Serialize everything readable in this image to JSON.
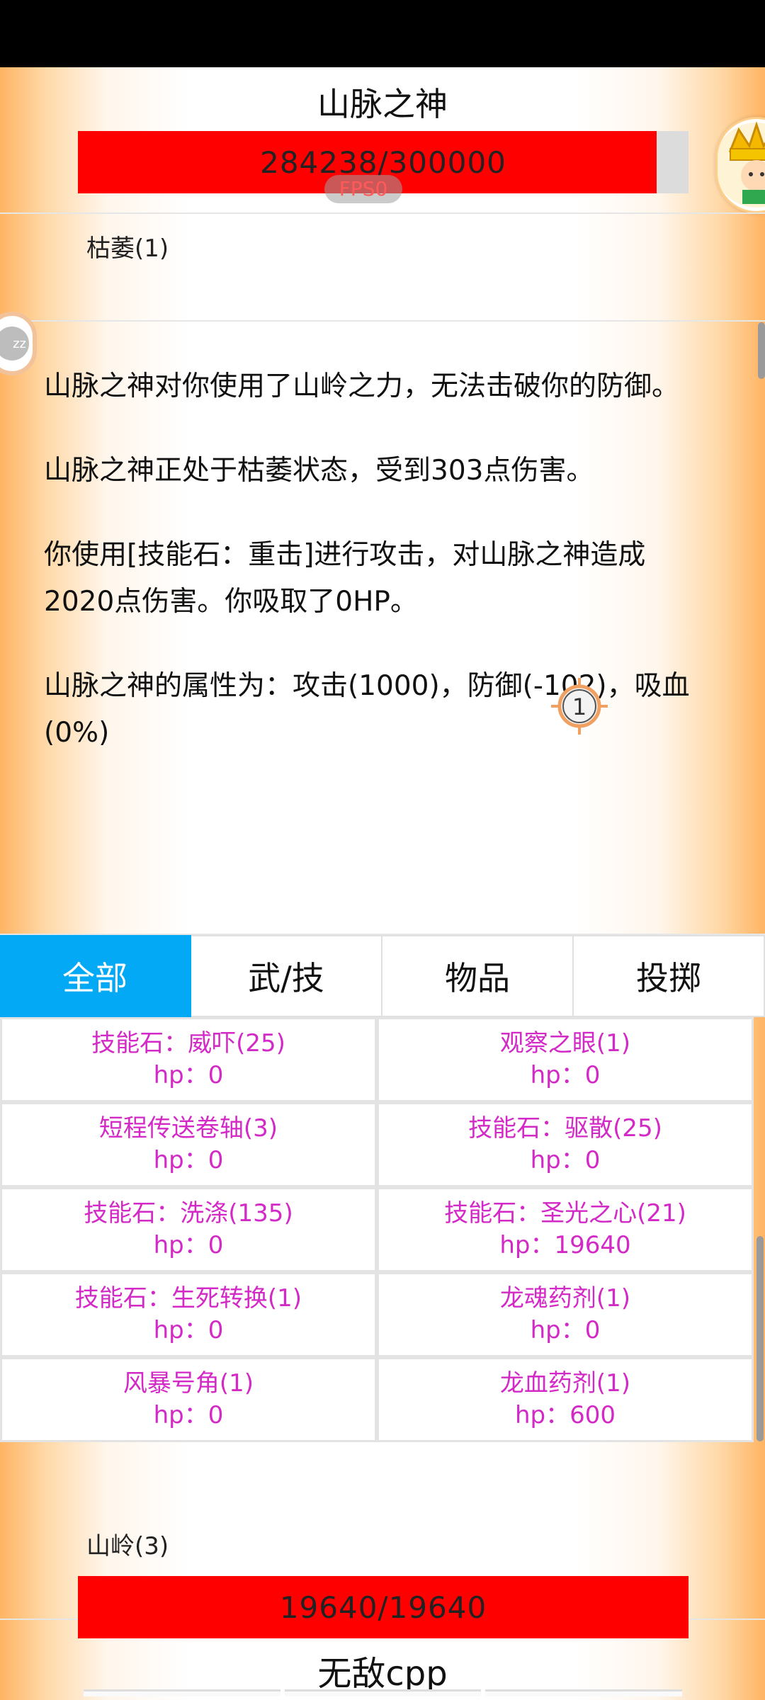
{
  "boss": {
    "name": "山脉之神",
    "hp_text": "284238/300000",
    "hp_fraction": 0.9475
  },
  "fps_label": "FPS0",
  "boss_status": "枯萎(1)",
  "log": [
    "山脉之神对你使用了山岭之力，无法击破你的防御。",
    "山脉之神正处于枯萎状态，受到303点伤害。",
    "你使用[技能石：重击]进行攻击，对山脉之神造成2020点伤害。你吸取了0HP。",
    "山脉之神的属性为：攻击(1000)，防御(-102)，吸血(0%)"
  ],
  "target_marker_number": "1",
  "tabs": [
    "全部",
    "武/技",
    "物品",
    "投掷"
  ],
  "active_tab": 0,
  "items": [
    {
      "name": "技能石：威吓(25)",
      "hp": "hp：0"
    },
    {
      "name": "观察之眼(1)",
      "hp": "hp：0"
    },
    {
      "name": "短程传送卷轴(3)",
      "hp": "hp：0"
    },
    {
      "name": "技能石：驱散(25)",
      "hp": "hp：0"
    },
    {
      "name": "技能石：洗涤(135)",
      "hp": "hp：0"
    },
    {
      "name": "技能石：圣光之心(21)",
      "hp": "hp：19640"
    },
    {
      "name": "技能石：生死转换(1)",
      "hp": "hp：0"
    },
    {
      "name": "龙魂药剂(1)",
      "hp": "hp：0"
    },
    {
      "name": "风暴号角(1)",
      "hp": "hp：0"
    },
    {
      "name": "龙血药剂(1)",
      "hp": "hp：600"
    }
  ],
  "player_status": "山岭(3)",
  "player": {
    "hp_text": "19640/19640",
    "hp_fraction": 1.0,
    "name": "无敌cpp"
  },
  "colors": {
    "hp_bar": "#ff0000",
    "active_tab": "#03a9f4",
    "item_text": "#d329c6"
  },
  "icons": {
    "avatar": "crowned-character-avatar",
    "sleep": "zz-sleep-icon",
    "target": "crosshair-target-icon"
  }
}
